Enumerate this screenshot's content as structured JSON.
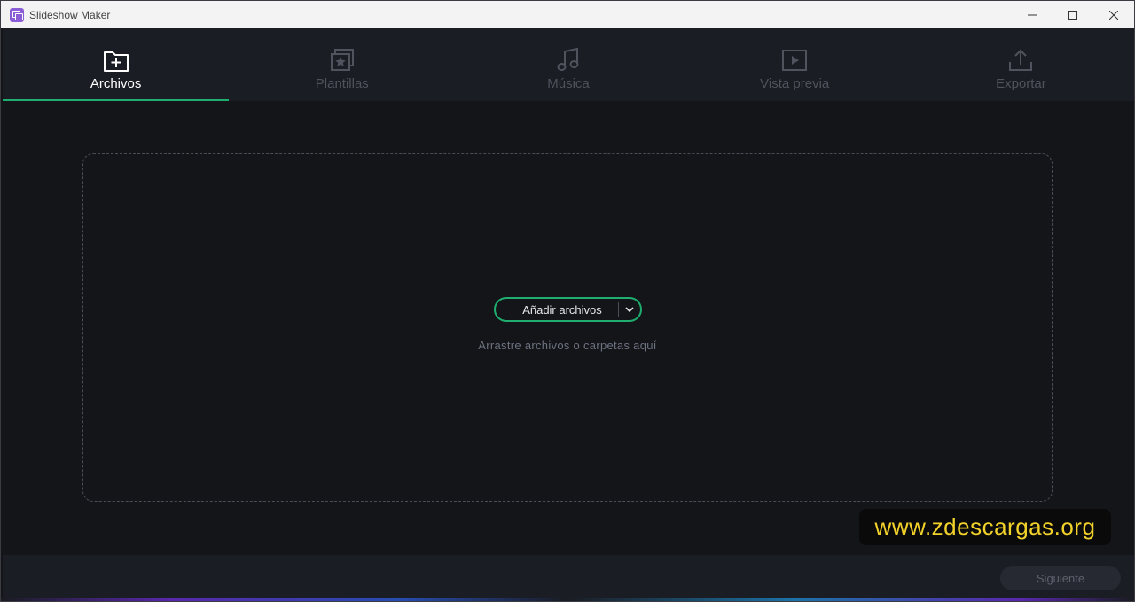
{
  "window": {
    "title": "Slideshow Maker",
    "controls": {
      "minimize": "—",
      "maximize": "☐",
      "close": "✕"
    }
  },
  "tabs": [
    {
      "label": "Archivos",
      "icon": "folder-add-icon",
      "active": true
    },
    {
      "label": "Plantillas",
      "icon": "template-star-icon",
      "active": false
    },
    {
      "label": "Música",
      "icon": "music-note-icon",
      "active": false
    },
    {
      "label": "Vista previa",
      "icon": "play-preview-icon",
      "active": false
    },
    {
      "label": "Exportar",
      "icon": "export-upload-icon",
      "active": false
    }
  ],
  "main": {
    "add_files_label": "Añadir archivos",
    "drop_hint": "Arrastre archivos o carpetas aquí"
  },
  "watermark": "www.zdescargas.org",
  "footer": {
    "next_label": "Siguiente"
  },
  "colors": {
    "accent": "#1fae6f",
    "background": "#131519",
    "panel": "#1b1d24",
    "inactive_text": "#4f535d",
    "watermark_text": "#f2d22a"
  }
}
